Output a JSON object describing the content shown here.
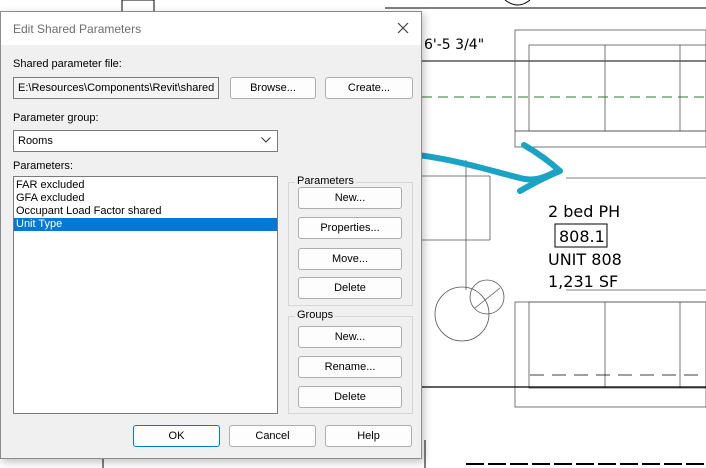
{
  "dialog": {
    "title": "Edit Shared Parameters",
    "shared_file_label": "Shared parameter file:",
    "shared_file_path": "E:\\Resources\\Components\\Revit\\shared",
    "browse_label": "Browse...",
    "create_label": "Create...",
    "group_label": "Parameter group:",
    "group_value": "Rooms",
    "parameters_label": "Parameters:",
    "parameters": [
      {
        "label": "FAR excluded",
        "selected": false
      },
      {
        "label": "GFA excluded",
        "selected": false
      },
      {
        "label": "Occupant Load Factor shared",
        "selected": false
      },
      {
        "label": "Unit Type",
        "selected": true
      }
    ],
    "parameters_group": {
      "legend": "Parameters",
      "new_label": "New...",
      "properties_label": "Properties...",
      "move_label": "Move...",
      "delete_label": "Delete"
    },
    "groups_group": {
      "legend": "Groups",
      "new_label": "New...",
      "rename_label": "Rename...",
      "delete_label": "Delete"
    },
    "ok_label": "OK",
    "cancel_label": "Cancel",
    "help_label": "Help"
  },
  "drawing": {
    "dimension_text": "6'-5 3/4\"",
    "room_name": "2 bed PH",
    "room_number": "808.1",
    "unit_label": "UNIT 808",
    "area_label": "1,231 SF",
    "annotation_color": "#1aa3c4"
  }
}
